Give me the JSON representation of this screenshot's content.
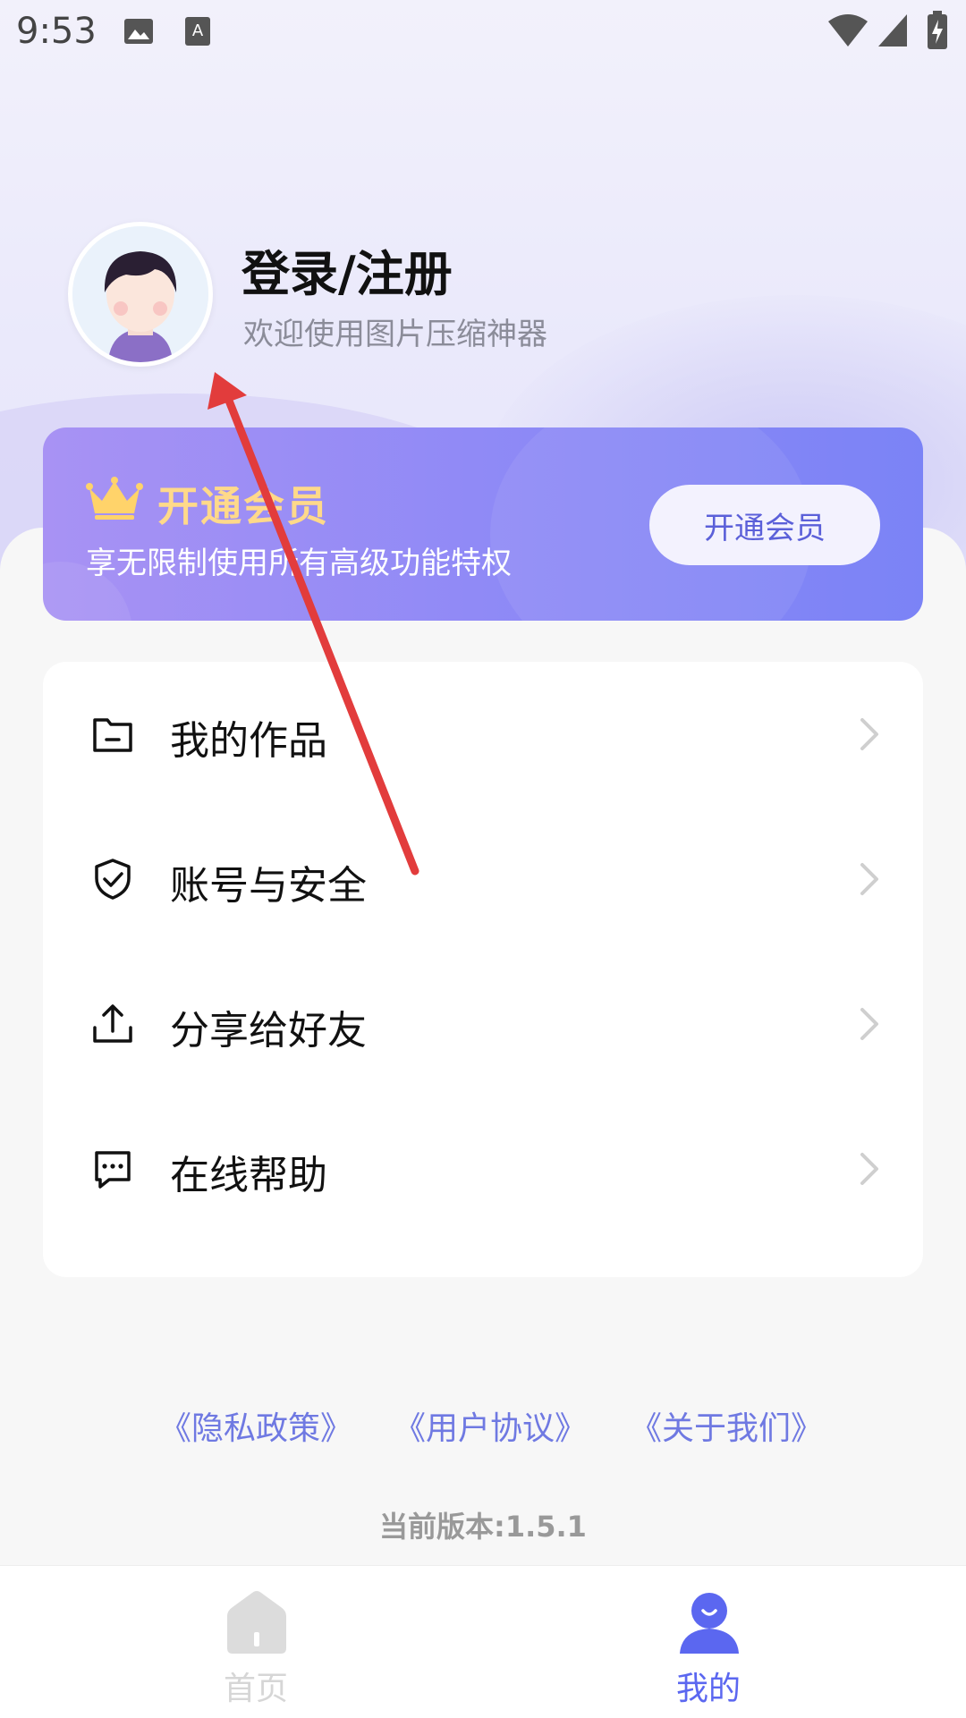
{
  "status_bar": {
    "time": "9:53"
  },
  "profile": {
    "title": "登录/注册",
    "subtitle": "欢迎使用图片压缩神器"
  },
  "vip_card": {
    "title": "开通会员",
    "subtitle": "享无限制使用所有高级功能特权",
    "button_label": "开通会员"
  },
  "menu": {
    "items": [
      {
        "label": "我的作品",
        "icon": "folder-icon"
      },
      {
        "label": "账号与安全",
        "icon": "shield-icon"
      },
      {
        "label": "分享给好友",
        "icon": "share-icon"
      },
      {
        "label": "在线帮助",
        "icon": "chat-icon"
      }
    ]
  },
  "footer_links": {
    "privacy": "《隐私政策》",
    "terms": "《用户协议》",
    "about": "《关于我们》"
  },
  "version": "当前版本:1.5.1",
  "tabbar": {
    "home_label": "首页",
    "mine_label": "我的",
    "active_color": "#5b67f0",
    "inactive_color": "#d8d8d8"
  }
}
